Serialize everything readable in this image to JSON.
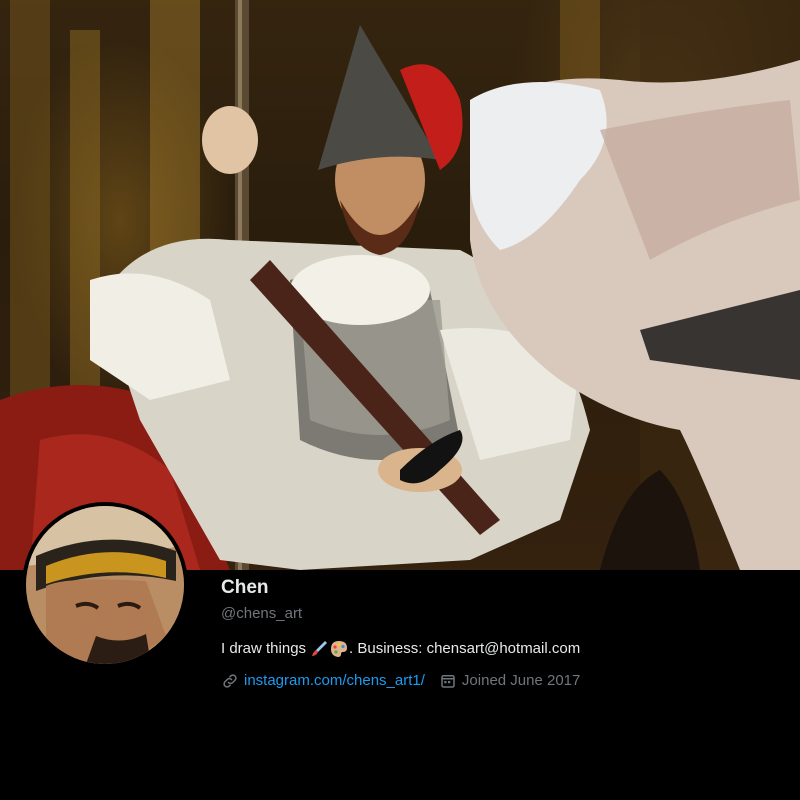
{
  "profile": {
    "display_name": "Chen",
    "handle": "@chens_art",
    "bio_prefix": "I draw things",
    "bio_suffix": ". Business: chensart@hotmail.com",
    "bio_emojis": [
      "paintbrush-emoji",
      "palette-emoji"
    ],
    "website_label": "instagram.com/chens_art1/",
    "joined_label": "Joined June 2017"
  },
  "icons": {
    "link": "link-icon",
    "calendar": "calendar-icon"
  },
  "colors": {
    "background": "#000000",
    "primary_text": "#e7e9ea",
    "secondary_text": "#71767b",
    "link": "#1d9bf0"
  }
}
